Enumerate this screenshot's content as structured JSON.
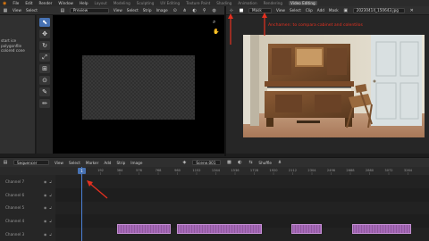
{
  "topbar": {
    "menus": [
      "File",
      "Edit",
      "Render",
      "Window",
      "Help"
    ],
    "workspaces": [
      "Layout",
      "Modeling",
      "Sculpting",
      "UV Editing",
      "Texture Paint",
      "Shading",
      "Animation",
      "Rendering",
      "Video Editing"
    ],
    "active_workspace": "Video Editing"
  },
  "preview_header": {
    "view_label": "View",
    "select_label": "Select",
    "mode_label": "Preview",
    "menus": [
      "View",
      "Select",
      "Strip",
      "Image"
    ]
  },
  "left_panel": {
    "info_lines": [
      "start ice polygonfile",
      "colored cone"
    ]
  },
  "tools": [
    {
      "icon": "select-cursor-icon",
      "glyph": "⬉",
      "active": true
    },
    {
      "icon": "move-icon",
      "glyph": "✥",
      "active": false
    },
    {
      "icon": "rotate-icon",
      "glyph": "↻",
      "active": false
    },
    {
      "icon": "scale-icon",
      "glyph": "⤢",
      "active": false
    },
    {
      "icon": "transform-icon",
      "glyph": "⊞",
      "active": false
    },
    {
      "icon": "pivot-icon",
      "glyph": "⊙",
      "active": false
    },
    {
      "icon": "eyedropper-icon",
      "glyph": "✎",
      "active": false
    },
    {
      "icon": "annotate-icon",
      "glyph": "✏",
      "active": false
    }
  ],
  "image_header": {
    "view_label": "View",
    "menus": [
      "View",
      "Select",
      "Clip",
      "Add",
      "Mask"
    ],
    "mode_label": "Mask",
    "filename": "20230414_150643.jpg"
  },
  "annotation_text": "Anchamen: to compara cabinet and colentilos",
  "sequencer": {
    "editor_label": "Sequencer",
    "menus": [
      "View",
      "Select",
      "Marker",
      "Add",
      "Strip",
      "Image"
    ],
    "scene_label": "Scene.001",
    "shuffle_label": "Shuffle",
    "ruler_ticks": [
      "1",
      "192",
      "384",
      "576",
      "768",
      "960",
      "1152",
      "1344",
      "1536",
      "1728",
      "1920",
      "2112",
      "2304",
      "2496",
      "2688",
      "2880",
      "3072",
      "3264"
    ],
    "current_frame": "1",
    "channels": [
      "Channel 7",
      "Channel 6",
      "Channel 5",
      "Channel 4",
      "Channel 3"
    ]
  },
  "colors": {
    "accent": "#4772b3",
    "strip": "#a668b8",
    "annotation": "#e43020"
  }
}
